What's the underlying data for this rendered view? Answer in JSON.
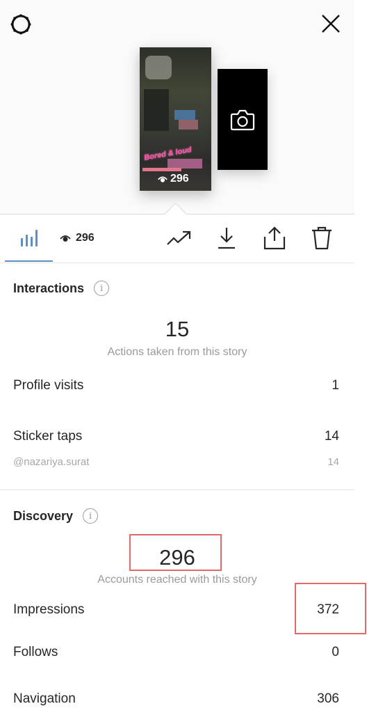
{
  "header": {
    "settings_icon": "settings-gear-icon",
    "close_icon": "close-icon"
  },
  "story": {
    "thumbnail_view_count": "296",
    "sticker_text": "Bored & loud",
    "next_story_icon": "camera-icon"
  },
  "toolbar": {
    "tabs": [
      {
        "id": "insights",
        "icon": "bar-chart-icon",
        "active": true
      },
      {
        "id": "viewers",
        "icon": "eye-icon",
        "label": "296"
      }
    ],
    "actions": [
      {
        "id": "promote",
        "icon": "trending-up-icon"
      },
      {
        "id": "download",
        "icon": "download-icon"
      },
      {
        "id": "share",
        "icon": "share-icon"
      },
      {
        "id": "delete",
        "icon": "trash-icon"
      }
    ],
    "accent_color": "#5b90c3"
  },
  "interactions": {
    "title": "Interactions",
    "total": "15",
    "caption": "Actions taken from this story",
    "rows": [
      {
        "label": "Profile visits",
        "value": "1"
      },
      {
        "label": "Sticker taps",
        "value": "14"
      }
    ],
    "sub_rows": [
      {
        "label": "@nazariya.surat",
        "value": "14"
      }
    ]
  },
  "discovery": {
    "title": "Discovery",
    "total": "296",
    "caption": "Accounts reached with this story",
    "rows": [
      {
        "label": "Impressions",
        "value": "372"
      },
      {
        "label": "Follows",
        "value": "0"
      },
      {
        "label": "Navigation",
        "value": "306"
      }
    ]
  },
  "annotations": {
    "highlight_color": "#e06a6a"
  }
}
